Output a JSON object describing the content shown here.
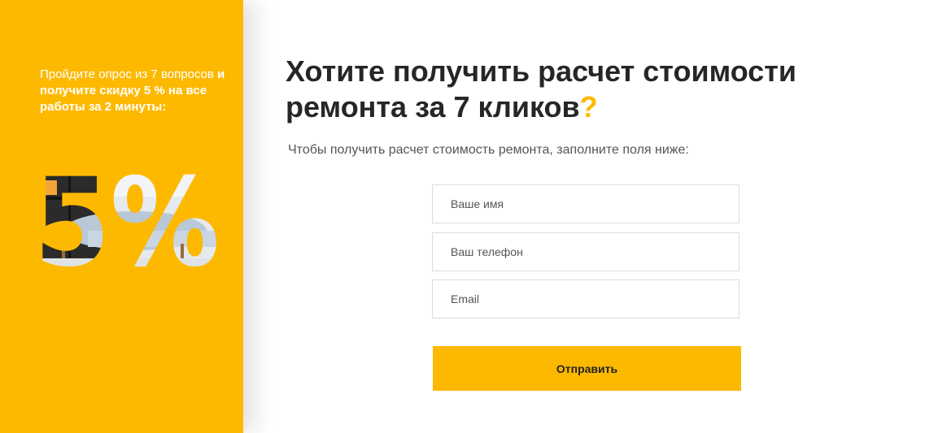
{
  "colors": {
    "accent": "#fdb900",
    "heading": "#262626",
    "text": "#555555",
    "white": "#ffffff"
  },
  "sidebar": {
    "promo_intro": "Пройдите опрос из 7 вопросов",
    "promo_bold": "и получите скидку 5 % на все работы за 2 минуты:",
    "big_percent": "5%"
  },
  "main": {
    "heading": "Хотите получить расчет стоимости ремонта за 7 кликов",
    "heading_mark": "?",
    "subtitle": "Чтобы получить расчет стоимость ремонта, заполните поля ниже:"
  },
  "form": {
    "name_placeholder": "Ваше имя",
    "phone_placeholder": "Ваш телефон",
    "email_placeholder": "Email",
    "submit_label": "Отправить"
  }
}
